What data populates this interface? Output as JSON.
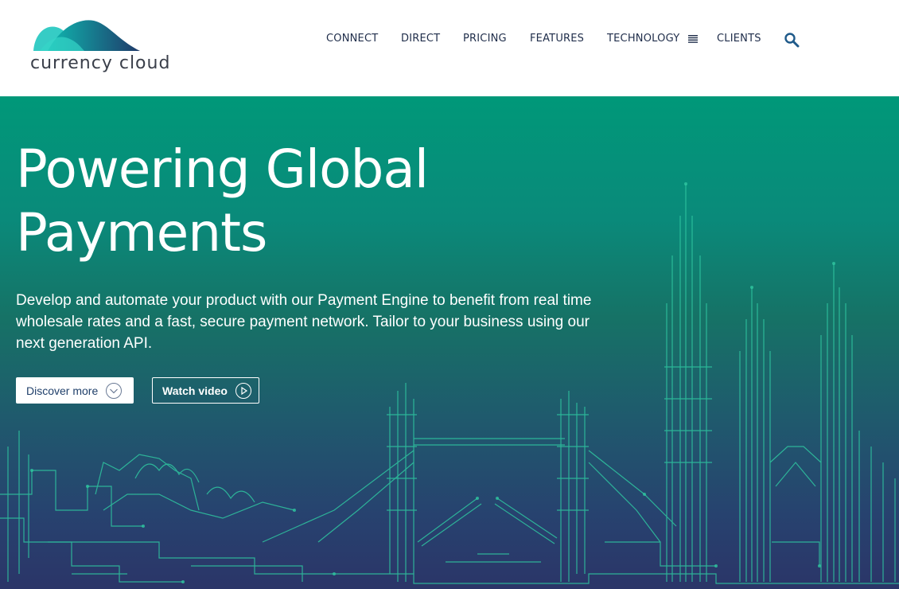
{
  "brand": {
    "name": "currency cloud"
  },
  "nav": {
    "items": [
      {
        "label": "CONNECT"
      },
      {
        "label": "DIRECT"
      },
      {
        "label": "PRICING"
      },
      {
        "label": "FEATURES"
      },
      {
        "label": "TECHNOLOGY"
      },
      {
        "label": "CLIENTS"
      }
    ],
    "search_icon": "search-icon",
    "menu_icon": "hamburger-icon"
  },
  "hero": {
    "title_line1": "Powering Global",
    "title_line2": "Payments",
    "description": "Develop and automate your product with our Payment Engine to benefit from real time wholesale rates and a fast, secure payment network. Tailor to your business using our next generation API.",
    "discover_label": "Discover more",
    "discover_icon": "chevron-down-circle-icon",
    "watch_label": "Watch video",
    "watch_icon": "play-circle-icon"
  },
  "colors": {
    "gradient_top": "#009879",
    "gradient_bottom": "#2b3568",
    "circuit": "#2fc6a0",
    "nav_text": "#1f2d4a"
  }
}
